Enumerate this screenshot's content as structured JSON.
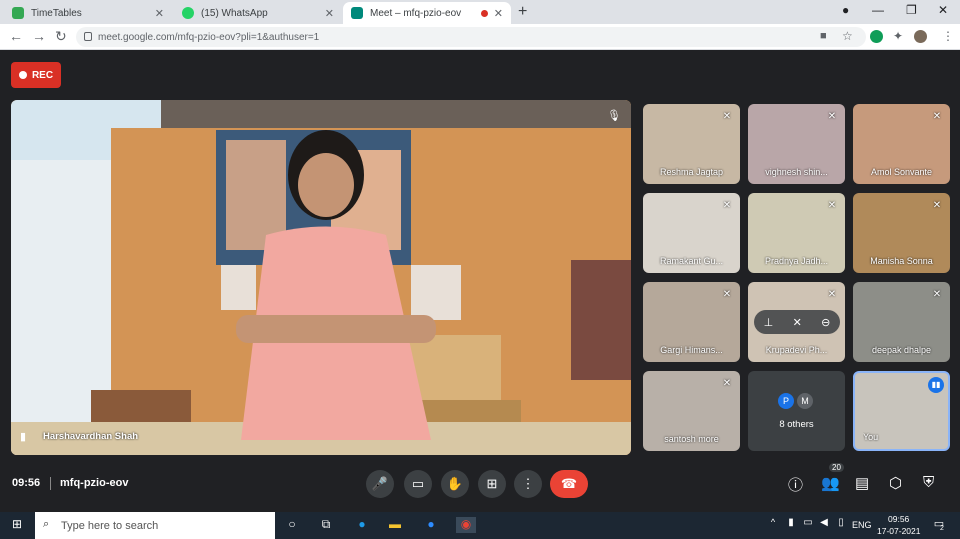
{
  "browser": {
    "tabs": [
      {
        "title": "TimeTables",
        "color": "#34a853"
      },
      {
        "title": "(15) WhatsApp",
        "color": "#25d366"
      },
      {
        "title": "Meet – mfq-pzio-eov",
        "color": "#00897b"
      }
    ],
    "url": "meet.google.com/mfq-pzio-eov?pli=1&authuser=1"
  },
  "meeting": {
    "rec_label": "REC",
    "time": "09:56",
    "code": "mfq-pzio-eov",
    "main_speaker": "Harshavardhan Shah",
    "participants_count": "20",
    "others_label": "8 others",
    "others_avatars": [
      "P",
      "M"
    ]
  },
  "tiles": [
    {
      "name": "Reshma Jagtap",
      "bg": "#c7b8a4"
    },
    {
      "name": "vighnesh shin...",
      "bg": "#b9a6a8"
    },
    {
      "name": "Amol Sonvante",
      "bg": "#c69a7c"
    },
    {
      "name": "Ramakant Gu...",
      "bg": "#d9d4cc"
    },
    {
      "name": "Pradnya Jadh...",
      "bg": "#cfcab4"
    },
    {
      "name": "Manisha Sonna",
      "bg": "#b08a5a"
    },
    {
      "name": "Gargi Himans...",
      "bg": "#b5a89a"
    },
    {
      "name": "Krupadevi Ph...",
      "bg": "#cfc3b4"
    },
    {
      "name": "deepak dhalpe",
      "bg": "#8d8e88"
    },
    {
      "name": "santosh more",
      "bg": "#b8b0a8"
    },
    {
      "name": "You",
      "bg": "#c8c4bc"
    }
  ],
  "taskbar": {
    "search_placeholder": "Type here to search",
    "lang": "ENG",
    "time": "09:56",
    "date": "17-07-2021",
    "notif_count": "2"
  }
}
